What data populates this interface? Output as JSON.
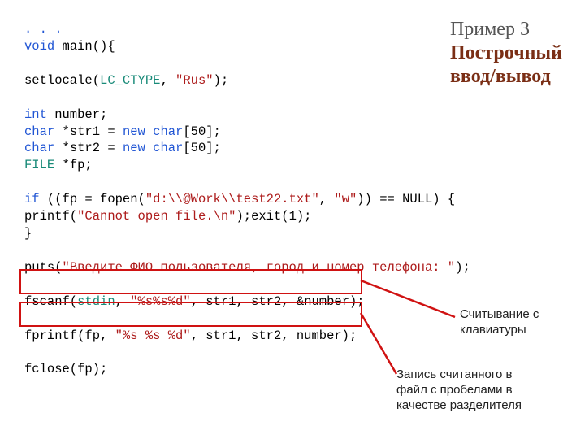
{
  "title": {
    "line1": "Пример 3",
    "line2": "Построчный",
    "line3": "ввод/вывод"
  },
  "code": {
    "l1a": ". . .",
    "l2a": "void",
    "l2b": " main(){",
    "l3a": "setlocale(",
    "l3b": "LC_CTYPE",
    "l3c": ", ",
    "l3d": "\"Rus\"",
    "l3e": ");",
    "l4a": "int",
    "l4b": " number;",
    "l5a": "char",
    "l5b": " *str1 = ",
    "l5c": "new",
    "l5d": " ",
    "l5e": "char",
    "l5f": "[50];",
    "l6a": "char",
    "l6b": " *str2 = ",
    "l6c": "new",
    "l6d": " ",
    "l6e": "char",
    "l6f": "[50];",
    "l7a": "FILE",
    "l7b": " *fp;",
    "l8a": "if",
    "l8b": " ((fp = fopen(",
    "l8c": "\"d:\\\\@Work\\\\test22.txt\"",
    "l8d": ", ",
    "l8e": "\"w\"",
    "l8f": ")) == NULL) {",
    "l9a": "printf(",
    "l9b": "\"Cannot open file.\\n\"",
    "l9c": ");exit(1);",
    "l10a": "}",
    "l11a": "puts(",
    "l11b": "\"Введите ФИО пользователя, город и номер телефона: \"",
    "l11c": ");",
    "l12a": "fscanf(",
    "l12b": "stdin",
    "l12c": ", ",
    "l12d": "\"%s%s%d\"",
    "l12e": ", str1, str2, &number);",
    "l13a": "fprintf(fp, ",
    "l13b": "\"%s %s %d\"",
    "l13c": ", str1, str2, number);",
    "l14a": "fclose(fp);"
  },
  "callouts": {
    "c1_l1": "Считывание с",
    "c1_l2": "клавиатуры",
    "c2_l1": "Запись считанного в",
    "c2_l2": "файл с пробелами в",
    "c2_l3": "качестве разделителя"
  }
}
